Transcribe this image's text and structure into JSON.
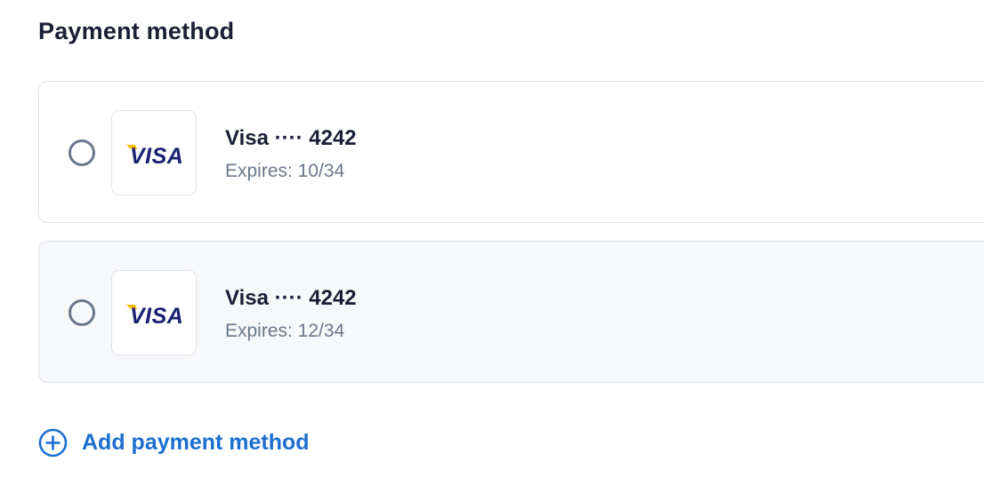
{
  "section": {
    "title": "Payment method"
  },
  "payment_methods": [
    {
      "brand_logo": "VISA",
      "name": "Visa ···· 4242",
      "expiry": "Expires: 10/34",
      "selected": false
    },
    {
      "brand_logo": "VISA",
      "name": "Visa ···· 4242",
      "expiry": "Expires: 12/34",
      "selected": false
    }
  ],
  "add_method": {
    "label": "Add payment method",
    "icon": "plus-circle-icon"
  },
  "colors": {
    "visa_blue": "#1a1f71",
    "visa_gold": "#f7b600",
    "link_blue": "#1c6fd1",
    "muted_text": "#6b778c",
    "alt_card_bg": "#f7f8fa"
  }
}
